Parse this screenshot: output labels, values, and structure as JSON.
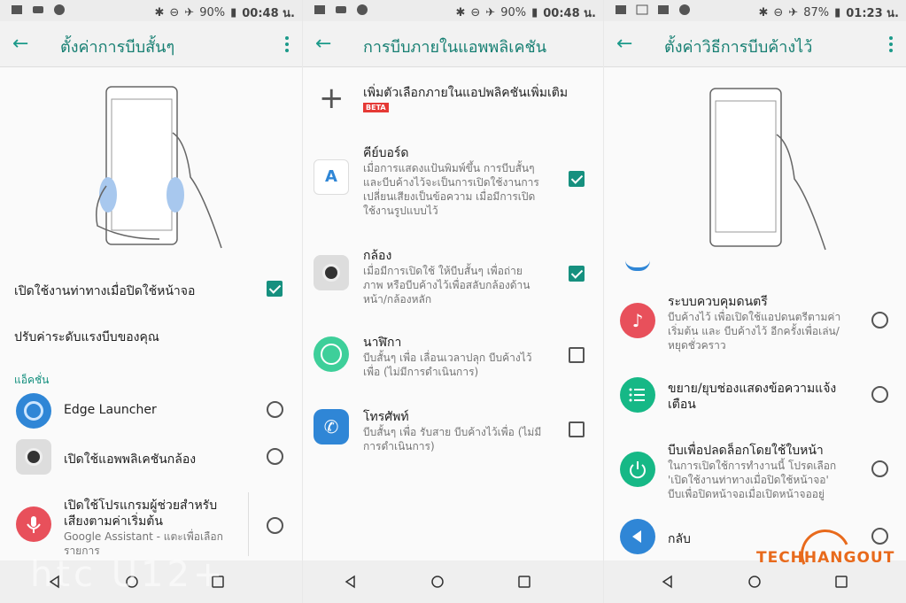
{
  "panels": [
    {
      "status": {
        "battery": "90%",
        "time": "00:48 น."
      },
      "title": "ตั้งค่าการบีบสั้นๆ",
      "items": {
        "enable_screen_off": "เปิดใช้งานท่าทางเมื่อปิดใช้หน้าจอ",
        "adjust_force": "ปรับค่าระดับแรงบีบของคุณ"
      },
      "section": "แอ็คชั่น",
      "actions": [
        {
          "label": "Edge Launcher"
        },
        {
          "label": "เปิดใช้แอพพลิเคชันกล้อง"
        },
        {
          "label": "เปิดใช้โปรแกรมผู้ช่วยสำหรับเสียงตามค่าเริ่มต้น",
          "label2": "เสียงตามค่าเริ่มต้น",
          "label1": "เปิดใช้โปรแกรมผู้ช่วยสำหรับ",
          "sub": "Google Assistant - แตะเพื่อเลือก",
          "sub2": "รายการ"
        }
      ],
      "watermark": "htc U12+"
    },
    {
      "status": {
        "battery": "90%",
        "time": "00:48 น."
      },
      "title": "การบีบภายในแอพพลิเคชัน",
      "add": {
        "label": "เพิ่มตัวเลือกภายในแอปพลิคชันเพิ่มเติม",
        "badge": "BETA"
      },
      "apps": [
        {
          "name": "คีย์บอร์ด",
          "desc1": "เมื่อการแสดงแป้นพิมพ์ขึ้น การบีบสั้นๆ",
          "desc2": "และบีบค้างไว้จะเป็นการเปิดใช้งานการ",
          "desc3": "เปลี่ยนเสียงเป็นข้อความ เมื่อมีการเปิด",
          "desc4": "ใช้งานรูปแบบไว้"
        },
        {
          "name": "กล้อง",
          "desc1": "เมื่อมีการเปิดใช้ ให้บีบสั้นๆ เพื่อถ่าย",
          "desc2": "ภาพ หรือบีบค้างไว้เพื่อสลับกล้องด้าน",
          "desc3": "หน้า/กล้องหลัก"
        },
        {
          "name": "นาฬิกา",
          "desc1": "บีบสั้นๆ เพื่อ เลื่อนเวลาปลุก บีบค้างไว้",
          "desc2": "เพื่อ (ไม่มีการดำเนินการ)"
        },
        {
          "name": "โทรศัพท์",
          "desc1": "บีบสั้นๆ เพื่อ รับสาย บีบค้างไว้เพื่อ (ไม่มี",
          "desc2": "การดำเนินการ)"
        }
      ]
    },
    {
      "status": {
        "battery": "87%",
        "time": "01:23 น."
      },
      "title": "ตั้งค่าวิธีการบีบค้างไว้",
      "options": [
        {
          "name": "ระบบควบคุมดนตรี",
          "desc1": "บีบค้างไว้ เพื่อเปิดใช้แอปดนตรีตามค่า",
          "desc2": "เริ่มต้น และ บีบค้างไว้ อีกครั้งเพื่อเล่น/",
          "desc3": "หยุดชั่วคราว"
        },
        {
          "name1": "ขยาย/ยุบช่องแสดงข้อความแจ้ง",
          "name2": "เตือน"
        },
        {
          "name": "บีบเพื่อปลดล็อกโดยใช้ใบหน้า",
          "desc1": "ในการเปิดใช้การทำงานนี้ โปรดเลือก",
          "desc2": "'เปิดใช้งานท่าทางเมื่อปิดใช้หน้าจอ'",
          "desc3": "บีบเพื่อปิดหน้าจอเมื่อเปิดหน้าจออยู่"
        },
        {
          "name": "กลับ"
        }
      ],
      "logo": "TECHHANGOUT"
    }
  ],
  "colors": {
    "accent": "#16907f",
    "title": "#167f72"
  }
}
